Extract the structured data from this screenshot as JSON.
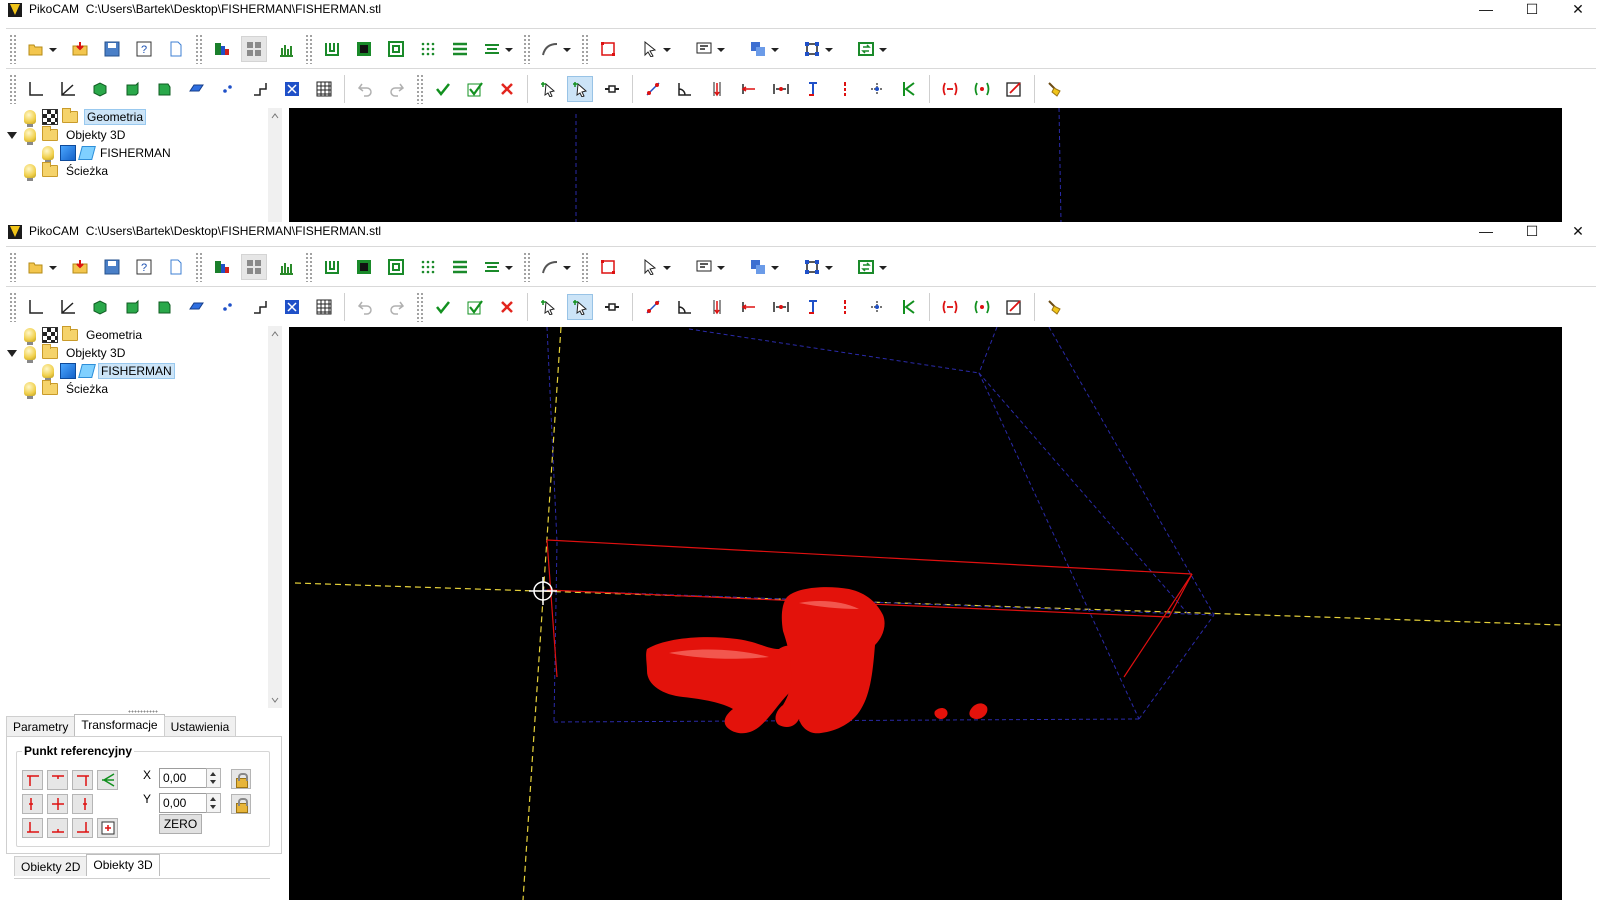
{
  "app": {
    "name": "PikoCAM",
    "path": "C:\\Users\\Bartek\\Desktop\\FISHERMAN\\FISHERMAN.stl"
  },
  "window_controls": {
    "minimize": "—",
    "maximize": "☐",
    "close": "✕"
  },
  "tree": {
    "items": [
      {
        "label": "Geometria",
        "icon": "geometry-layer-icon"
      },
      {
        "label": "Objekty 3D",
        "icon": "folder-icon"
      },
      {
        "label": "FISHERMAN",
        "icon": "mesh-object-icon"
      },
      {
        "label": "Ścieżka",
        "icon": "folder-icon"
      }
    ],
    "selected_top": "Geometria",
    "selected_bottom": "FISHERMAN"
  },
  "tabs_top": [
    "Parametry",
    "Transformacje",
    "Ustawienia"
  ],
  "tabs_top_active": "Transformacje",
  "panel": {
    "group_title": "Punkt referencyjny",
    "x_label": "X",
    "y_label": "Y",
    "x_value": "0,00",
    "y_value": "0,00",
    "zero_label": "ZERO"
  },
  "tabs_bottom": [
    "Obiekty 2D",
    "Obiekty 3D"
  ],
  "tabs_bottom_active": "Obiekty 3D",
  "colors": {
    "viewport_bg": "#000000",
    "model": "#e3120b",
    "axis_yellow": "#e6d23a",
    "bbox_blue": "#2a2aa8",
    "bbox_red": "#e01010"
  }
}
